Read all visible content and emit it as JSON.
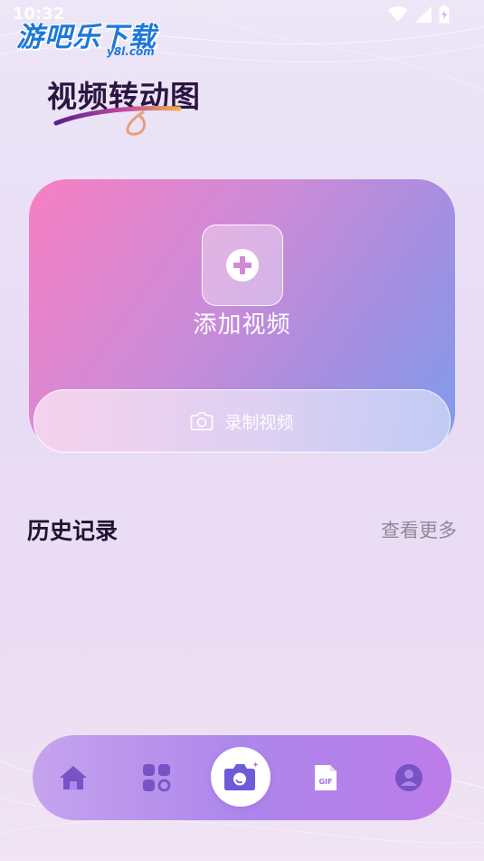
{
  "status_bar": {
    "time": "10:32",
    "icons": [
      "wifi-icon",
      "signal-icon",
      "battery-charging-icon"
    ]
  },
  "watermark": {
    "text": "游吧乐下载",
    "sub": "y8l.com"
  },
  "header": {
    "title": "视频转动图"
  },
  "hero": {
    "add_label": "添加视频",
    "record_label": "录制视频",
    "gradient": [
      "#f77fc3",
      "#7f9ceb"
    ]
  },
  "history": {
    "title": "历史记录",
    "more_label": "查看更多"
  },
  "tabbar": {
    "tabs": [
      {
        "icon": "home-icon"
      },
      {
        "icon": "apps-grid-icon"
      },
      {
        "icon": "camera-icon",
        "active": true
      },
      {
        "icon": "gif-file-icon",
        "label": "GIF"
      },
      {
        "icon": "profile-icon"
      }
    ],
    "colors": {
      "bar": "#ad86ec",
      "icon": "#7a52c6",
      "center_icon": "#6f5ad8"
    }
  }
}
